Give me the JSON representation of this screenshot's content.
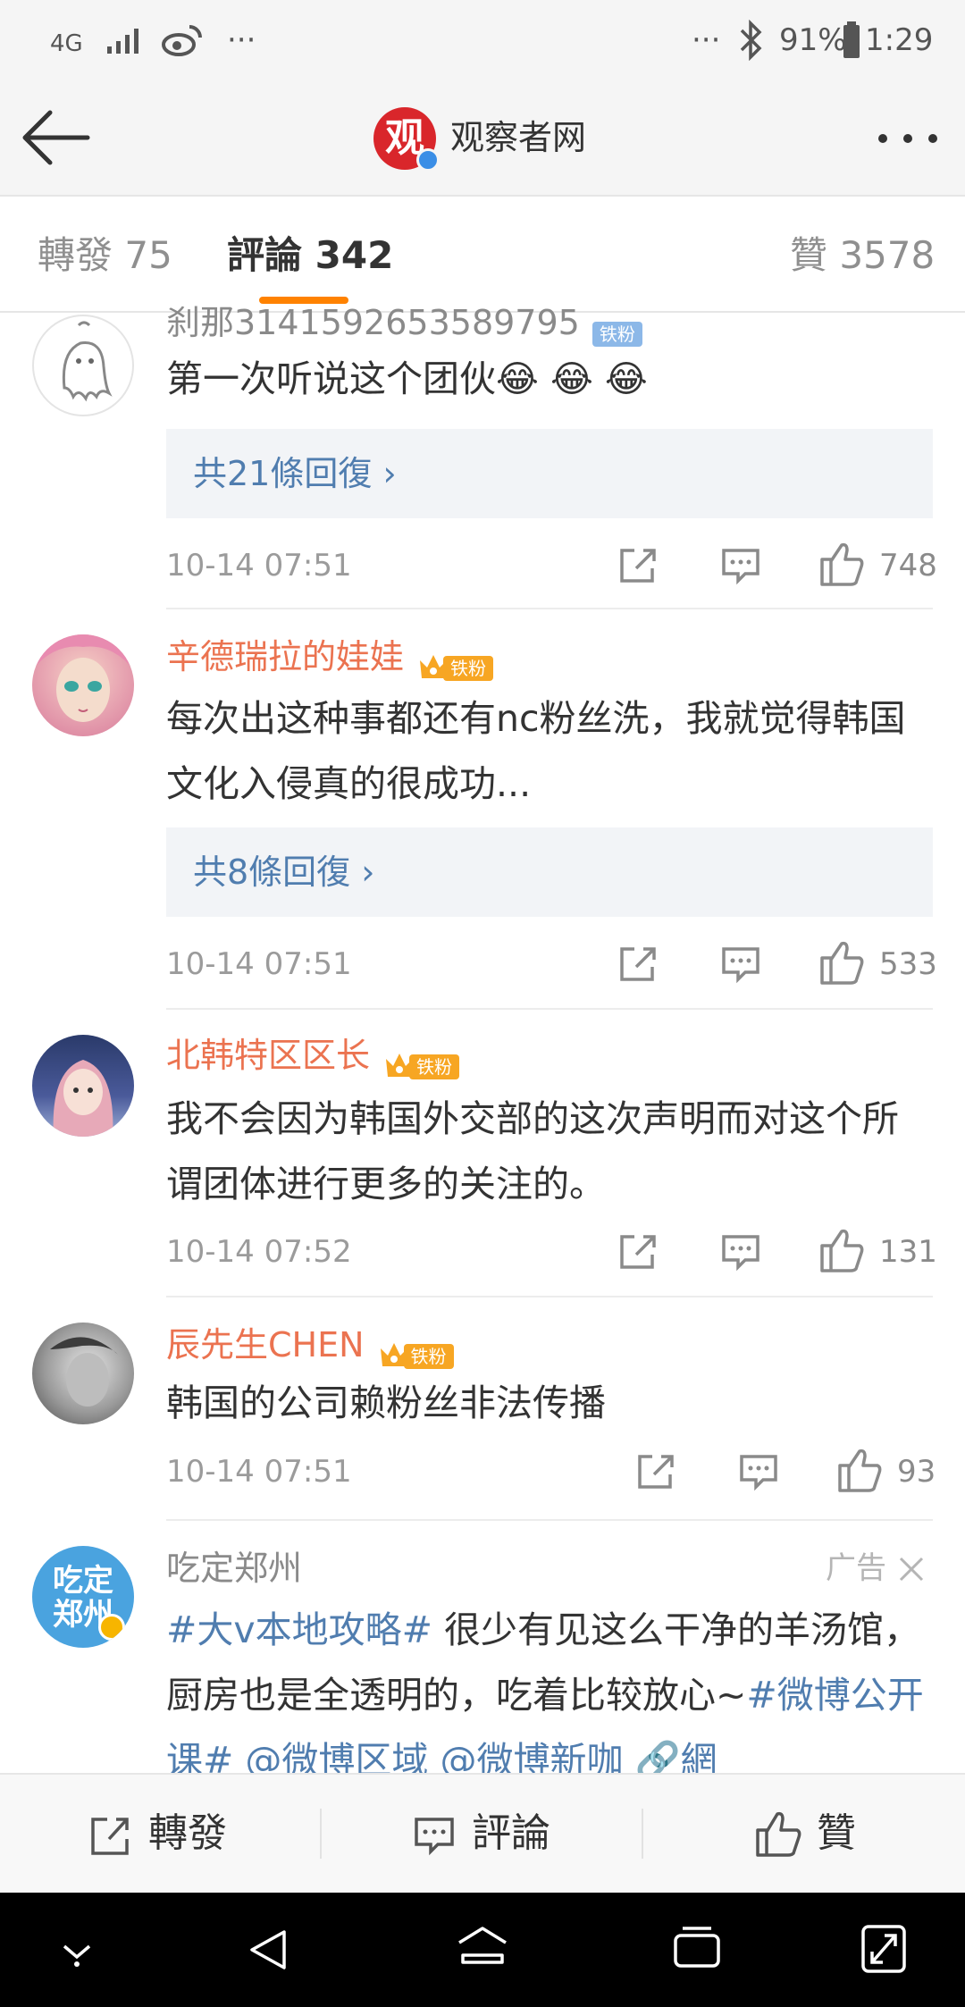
{
  "status_bar": {
    "network": "4G",
    "dots_left": "···",
    "dots_right": "···",
    "battery": "91%",
    "time": "1:29"
  },
  "navbar": {
    "title": "观察者网",
    "logo_char": "观"
  },
  "tabs": [
    {
      "label": "轉發 75"
    },
    {
      "label": "評論 342"
    },
    {
      "label": "贊 3578"
    }
  ],
  "comments": [
    {
      "name": "刹那3141592653589795",
      "badge": "铁粉",
      "text": "第一次听说这个团伙😂 😂 😂",
      "replies": "共21條回復",
      "time": "10-14 07:51",
      "likes": "748"
    },
    {
      "name": "辛德瑞拉的娃娃",
      "badge": "铁粉",
      "text": "每次出这种事都还有nc粉丝洗，我就觉得韩国文化入侵真的很成功...",
      "replies": "共8條回復",
      "time": "10-14 07:51",
      "likes": "533"
    },
    {
      "name": "北韩特区区长",
      "badge": "铁粉",
      "text": "我不会因为韩国外交部的这次声明而对这个所谓团体进行更多的关注的。",
      "time": "10-14 07:52",
      "likes": "131"
    },
    {
      "name": "辰先生CHEN",
      "badge": "铁粉",
      "text": "韩国的公司赖粉丝非法传播",
      "time": "10-14 07:51",
      "likes": "93"
    }
  ],
  "ad": {
    "name": "吃定郑州",
    "label": "广告",
    "avatar_text": "吃定郑州",
    "text_hashtag1": "#大v本地攻略#",
    "text_body": " 很少有见这么干净的羊汤馆，厨房也是全透明的，吃着比较放心~",
    "text_hashtag2": "#微博公开课#",
    "text_mention1": " @微博区域",
    "text_mention2": " @微博新咖",
    "text_link": " 🔗網"
  },
  "bottom_bar": {
    "repost": "轉發",
    "comment": "評論",
    "like": "贊"
  },
  "colors": {
    "accent": "#ff8200",
    "name": "#eb7350",
    "link": "#507daf"
  }
}
